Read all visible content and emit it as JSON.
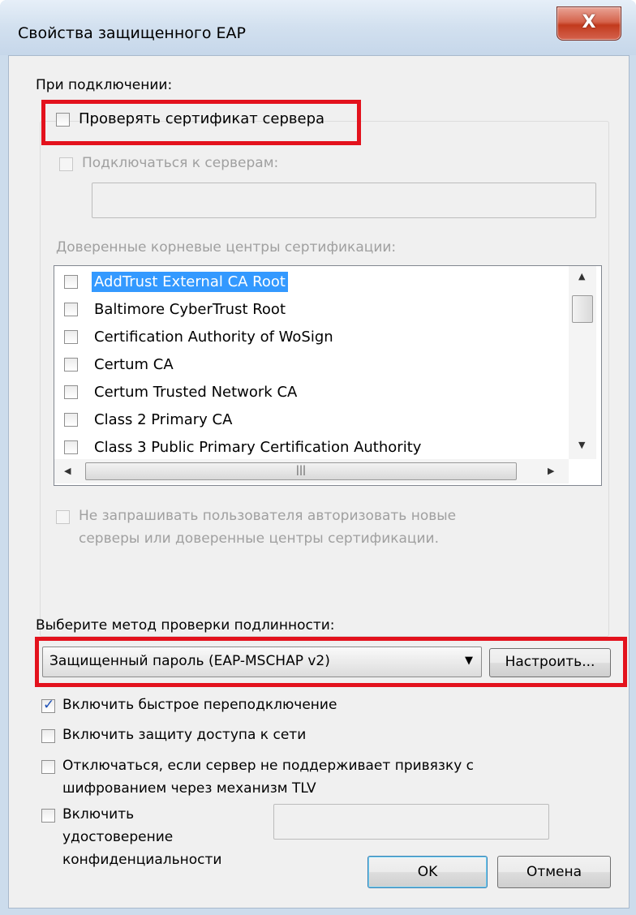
{
  "window": {
    "title": "Свойства защищенного EAP",
    "close_label": "X"
  },
  "connect_section": {
    "label": "При подключении:"
  },
  "verify_cert": {
    "label": "Проверять сертификат сервера",
    "checked": false
  },
  "connect_to_servers": {
    "label": "Подключаться к серверам:",
    "checked": false,
    "value": ""
  },
  "trusted_roots": {
    "label": "Доверенные корневые центры сертификации:",
    "items": [
      {
        "label": "AddTrust External CA Root",
        "checked": false,
        "selected": true
      },
      {
        "label": "Baltimore CyberTrust Root",
        "checked": false,
        "selected": false
      },
      {
        "label": "Certification Authority of WoSign",
        "checked": false,
        "selected": false
      },
      {
        "label": "Certum CA",
        "checked": false,
        "selected": false
      },
      {
        "label": "Certum Trusted Network CA",
        "checked": false,
        "selected": false
      },
      {
        "label": "Class 2 Primary CA",
        "checked": false,
        "selected": false
      },
      {
        "label": "Class 3 Public Primary Certification Authority",
        "checked": false,
        "selected": false
      }
    ]
  },
  "dont_prompt": {
    "line1": "Не запрашивать пользователя авторизовать новые",
    "line2": "серверы или доверенные центры сертификации.",
    "checked": false
  },
  "auth_method": {
    "label": "Выберите метод проверки подлинности:",
    "selected": "Защищенный пароль (EAP-MSCHAP v2)",
    "configure_label": "Настроить..."
  },
  "options": {
    "fast_reconnect": {
      "label": "Включить быстрое переподключение",
      "checked": true
    },
    "nap": {
      "label": "Включить защиту доступа к сети",
      "checked": false
    },
    "disconnect_tlv": {
      "line1": "Отключаться, если сервер не поддерживает привязку с",
      "line2": "шифрованием через механизм TLV",
      "checked": false
    },
    "identity_privacy": {
      "line1": "Включить",
      "line2": "удостоверение",
      "line3": "конфиденциальности",
      "checked": false,
      "value": ""
    }
  },
  "buttons": {
    "ok": "OK",
    "cancel": "Отмена"
  },
  "colors": {
    "highlight": "#e3121d",
    "selection": "#3399ff",
    "check": "#1c4fb5"
  }
}
